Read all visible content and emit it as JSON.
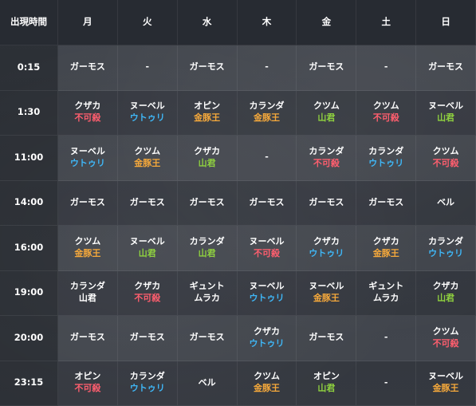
{
  "colors": {
    "red": "#ff5e6e",
    "blue": "#3fb6f5",
    "orange": "#f6a93b",
    "green": "#8fd13f",
    "white": "#ffffff"
  },
  "header": {
    "corner": "出現時間",
    "days": [
      "月",
      "火",
      "水",
      "木",
      "金",
      "土",
      "日"
    ]
  },
  "rows": [
    {
      "time": "0:15",
      "cells": [
        {
          "name": "ガーモス",
          "sub": "",
          "sub_color": ""
        },
        {
          "name": "-",
          "sub": "",
          "sub_color": ""
        },
        {
          "name": "ガーモス",
          "sub": "",
          "sub_color": ""
        },
        {
          "name": "-",
          "sub": "",
          "sub_color": ""
        },
        {
          "name": "ガーモス",
          "sub": "",
          "sub_color": ""
        },
        {
          "name": "-",
          "sub": "",
          "sub_color": ""
        },
        {
          "name": "ガーモス",
          "sub": "",
          "sub_color": ""
        }
      ]
    },
    {
      "time": "1:30",
      "cells": [
        {
          "name": "クザカ",
          "sub": "不可殺",
          "sub_color": "red"
        },
        {
          "name": "ヌーベル",
          "sub": "ウトゥリ",
          "sub_color": "blue"
        },
        {
          "name": "オピン",
          "sub": "金豚王",
          "sub_color": "orange"
        },
        {
          "name": "カランダ",
          "sub": "金豚王",
          "sub_color": "orange"
        },
        {
          "name": "クツム",
          "sub": "山君",
          "sub_color": "green"
        },
        {
          "name": "クツム",
          "sub": "不可殺",
          "sub_color": "red"
        },
        {
          "name": "ヌーベル",
          "sub": "山君",
          "sub_color": "green"
        }
      ]
    },
    {
      "time": "11:00",
      "cells": [
        {
          "name": "ヌーベル",
          "sub": "ウトゥリ",
          "sub_color": "blue"
        },
        {
          "name": "クツム",
          "sub": "金豚王",
          "sub_color": "orange"
        },
        {
          "name": "クザカ",
          "sub": "山君",
          "sub_color": "green"
        },
        {
          "name": "-",
          "sub": "",
          "sub_color": ""
        },
        {
          "name": "カランダ",
          "sub": "不可殺",
          "sub_color": "red"
        },
        {
          "name": "カランダ",
          "sub": "ウトゥリ",
          "sub_color": "blue"
        },
        {
          "name": "クツム",
          "sub": "不可殺",
          "sub_color": "red"
        }
      ]
    },
    {
      "time": "14:00",
      "cells": [
        {
          "name": "ガーモス",
          "sub": "",
          "sub_color": ""
        },
        {
          "name": "ガーモス",
          "sub": "",
          "sub_color": ""
        },
        {
          "name": "ガーモス",
          "sub": "",
          "sub_color": ""
        },
        {
          "name": "ガーモス",
          "sub": "",
          "sub_color": ""
        },
        {
          "name": "ガーモス",
          "sub": "",
          "sub_color": ""
        },
        {
          "name": "ガーモス",
          "sub": "",
          "sub_color": ""
        },
        {
          "name": "ベル",
          "sub": "",
          "sub_color": ""
        }
      ]
    },
    {
      "time": "16:00",
      "cells": [
        {
          "name": "クツム",
          "sub": "金豚王",
          "sub_color": "orange"
        },
        {
          "name": "ヌーベル",
          "sub": "山君",
          "sub_color": "green"
        },
        {
          "name": "カランダ",
          "sub": "山君",
          "sub_color": "green"
        },
        {
          "name": "ヌーベル",
          "sub": "不可殺",
          "sub_color": "red"
        },
        {
          "name": "クザカ",
          "sub": "ウトゥリ",
          "sub_color": "blue"
        },
        {
          "name": "クザカ",
          "sub": "金豚王",
          "sub_color": "orange"
        },
        {
          "name": "カランダ",
          "sub": "ウトゥリ",
          "sub_color": "blue"
        }
      ]
    },
    {
      "time": "19:00",
      "cells": [
        {
          "name": "カランダ",
          "sub": "山君",
          "sub_color": "white"
        },
        {
          "name": "クザカ",
          "sub": "不可殺",
          "sub_color": "red"
        },
        {
          "name": "ギュント",
          "sub": "ムラカ",
          "sub_color": "white"
        },
        {
          "name": "ヌーベル",
          "sub": "ウトゥリ",
          "sub_color": "blue"
        },
        {
          "name": "ヌーベル",
          "sub": "金豚王",
          "sub_color": "orange"
        },
        {
          "name": "ギュント",
          "sub": "ムラカ",
          "sub_color": "white"
        },
        {
          "name": "クザカ",
          "sub": "山君",
          "sub_color": "green"
        }
      ]
    },
    {
      "time": "20:00",
      "cells": [
        {
          "name": "ガーモス",
          "sub": "",
          "sub_color": ""
        },
        {
          "name": "ガーモス",
          "sub": "",
          "sub_color": ""
        },
        {
          "name": "ガーモス",
          "sub": "",
          "sub_color": ""
        },
        {
          "name": "クザカ",
          "sub": "ウトゥリ",
          "sub_color": "blue"
        },
        {
          "name": "ガーモス",
          "sub": "",
          "sub_color": ""
        },
        {
          "name": "-",
          "sub": "",
          "sub_color": ""
        },
        {
          "name": "クツム",
          "sub": "不可殺",
          "sub_color": "red"
        }
      ]
    },
    {
      "time": "23:15",
      "cells": [
        {
          "name": "オピン",
          "sub": "不可殺",
          "sub_color": "red"
        },
        {
          "name": "カランダ",
          "sub": "ウトゥリ",
          "sub_color": "blue"
        },
        {
          "name": "ベル",
          "sub": "",
          "sub_color": ""
        },
        {
          "name": "クツム",
          "sub": "金豚王",
          "sub_color": "orange"
        },
        {
          "name": "オピン",
          "sub": "山君",
          "sub_color": "green"
        },
        {
          "name": "-",
          "sub": "",
          "sub_color": ""
        },
        {
          "name": "ヌーベル",
          "sub": "金豚王",
          "sub_color": "orange"
        }
      ]
    }
  ]
}
